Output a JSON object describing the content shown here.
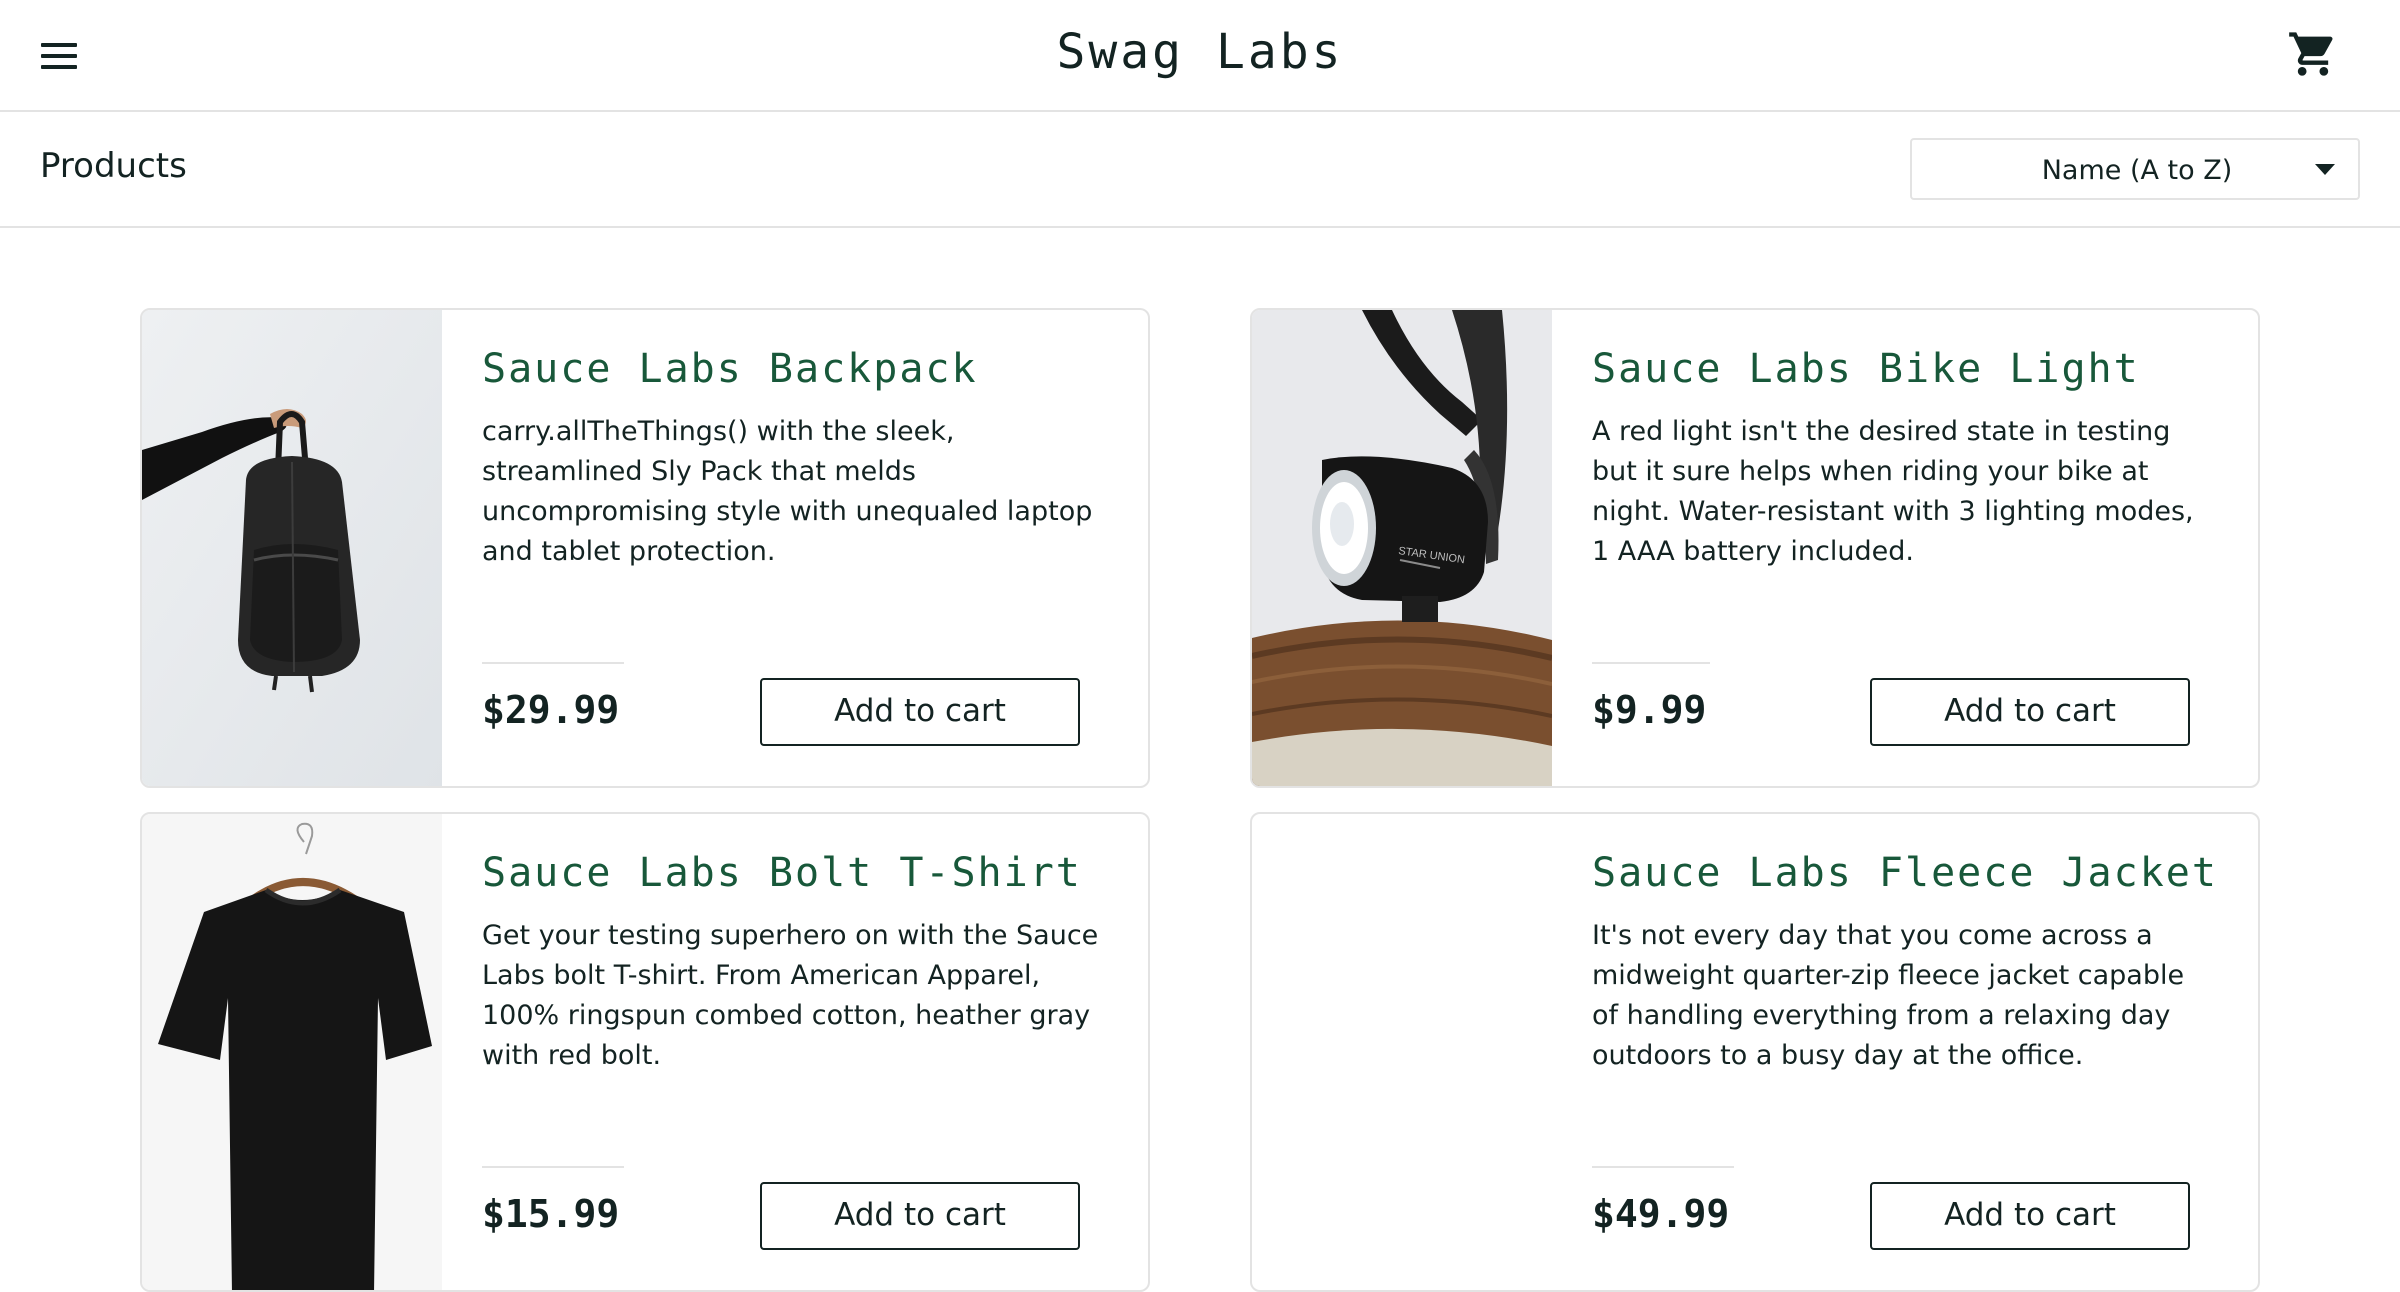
{
  "header": {
    "logo": "Swag Labs",
    "menu_icon": "hamburger-menu-icon",
    "cart_icon": "shopping-cart-icon"
  },
  "subheader": {
    "title": "Products",
    "sort": {
      "selected": "Name (A to Z)",
      "caret_icon": "caret-down-icon"
    }
  },
  "colors": {
    "product_name": "#18583a",
    "text": "#132322",
    "border": "#e3e3e3"
  },
  "products": [
    {
      "name": "Sauce Labs Backpack",
      "description": "carry.allTheThings() with the sleek, streamlined Sly Pack that melds uncompromising style with unequaled laptop and tablet protection.",
      "price": "$29.99",
      "button": "Add to cart",
      "image_icon": "backpack-image"
    },
    {
      "name": "Sauce Labs Bike Light",
      "description": "A red light isn't the desired state in testing but it sure helps when riding your bike at night. Water-resistant with 3 lighting modes, 1 AAA battery included.",
      "price": "$9.99",
      "button": "Add to cart",
      "image_icon": "bike-light-image",
      "image_text": "STAR UNION"
    },
    {
      "name": "Sauce Labs Bolt T-Shirt",
      "description": "Get your testing superhero on with the Sauce Labs bolt T-shirt. From American Apparel, 100% ringspun combed cotton, heather gray with red bolt.",
      "price": "$15.99",
      "button": "Add to cart",
      "image_icon": "tshirt-image"
    },
    {
      "name": "Sauce Labs Fleece Jacket",
      "description": "It's not every day that you come across a midweight quarter-zip fleece jacket capable of handling everything from a relaxing day outdoors to a busy day at the office.",
      "price": "$49.99",
      "button": "Add to cart",
      "image_icon": "fleece-jacket-image"
    }
  ]
}
